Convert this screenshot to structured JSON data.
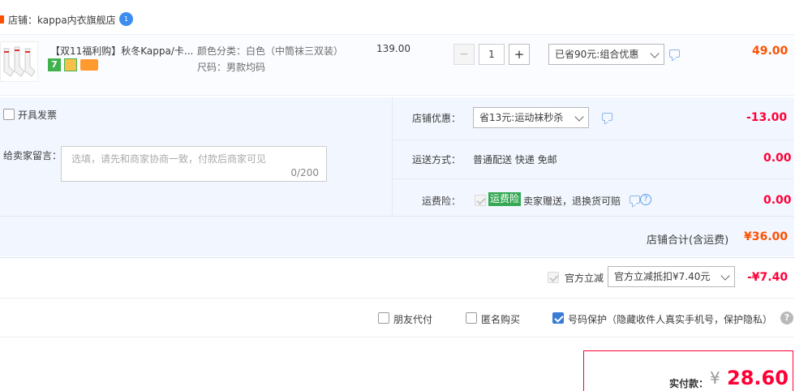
{
  "shop": {
    "label": "店铺：kappa内衣旗舰店"
  },
  "item": {
    "title": "【双11福利购】秋冬Kappa/卡...",
    "spec_color": "颜色分类：白色（中筒袜三双装）",
    "spec_size": "尺码：男款均码",
    "price": "139.00",
    "qty": "1",
    "qty_minus": "−",
    "qty_plus": "+",
    "promo": "已省90元:组合优惠",
    "subtotal": "49.00",
    "badge_seven": "7"
  },
  "invoice": {
    "label": "开具发票"
  },
  "message": {
    "label": "给卖家留言：",
    "placeholder": "选填，请先和商家协商一致，付款后商家可见",
    "counter": "0/200"
  },
  "shop_discount": {
    "label": "店铺优惠：",
    "value": "省13元:运动袜秒杀",
    "amount": "-13.00"
  },
  "shipping": {
    "label": "运送方式：",
    "value": "普通配送 快递 免邮",
    "amount": "0.00"
  },
  "insurance": {
    "label": "运费险：",
    "tag": "运费险",
    "desc": "卖家赠送，退换货可赔",
    "amount": "0.00"
  },
  "shop_total": {
    "label": "店铺合计(含运费)",
    "amount": "¥36.00"
  },
  "official": {
    "label": "官方立减",
    "value": "官方立减抵扣¥7.40元",
    "amount": "-¥7.40"
  },
  "options": {
    "friend_pay": "朋友代付",
    "anonymous": "匿名购买",
    "phone_protect": "号码保护（隐藏收件人真实手机号，保护隐私）"
  },
  "payment": {
    "label": "实付款：",
    "currency": "¥",
    "amount": "28.60"
  },
  "colors": {
    "accent": "#ff0036",
    "orange": "#ff5000",
    "panel": "#f2f7ff",
    "tag_green": "#34a853"
  }
}
